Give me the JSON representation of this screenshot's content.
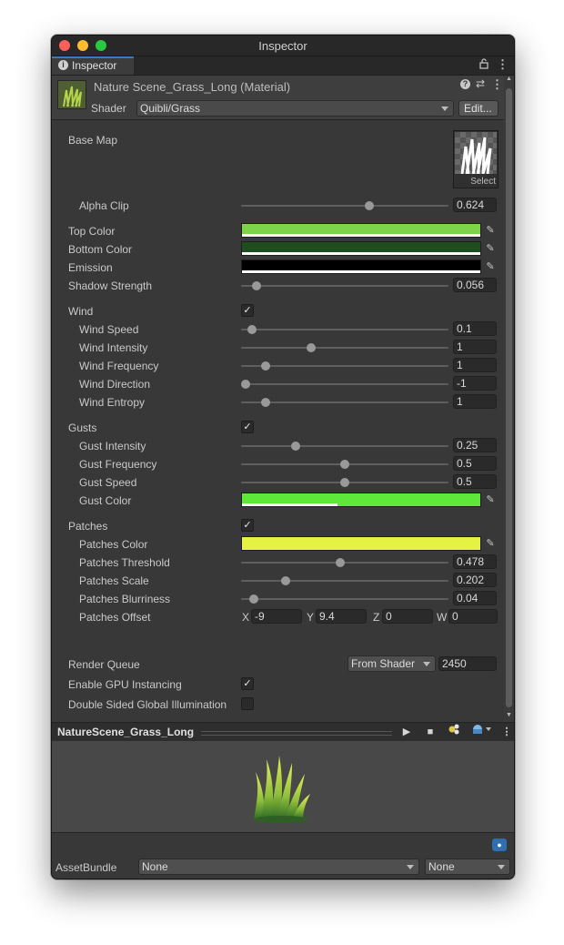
{
  "window": {
    "title": "Inspector"
  },
  "tab": {
    "label": "Inspector"
  },
  "header": {
    "material_name": "Nature Scene_Grass_Long (Material)",
    "shader_label": "Shader",
    "shader_value": "Quibli/Grass",
    "edit_button": "Edit..."
  },
  "basemap": {
    "label": "Base Map",
    "select_label": "Select"
  },
  "alpha_clip": {
    "label": "Alpha Clip",
    "value": "0.624",
    "fraction": 0.624
  },
  "colors": {
    "top": {
      "label": "Top Color",
      "hex": "#7ed448"
    },
    "bottom": {
      "label": "Bottom Color",
      "hex": "#1e4d1e"
    },
    "emission": {
      "label": "Emission",
      "hex": "#000000"
    }
  },
  "shadow_strength": {
    "label": "Shadow Strength",
    "value": "0.056",
    "fraction": 0.056
  },
  "wind": {
    "label": "Wind",
    "checked": true,
    "speed": {
      "label": "Wind Speed",
      "value": "0.1",
      "fraction": 0.03
    },
    "intensity": {
      "label": "Wind Intensity",
      "value": "1",
      "fraction": 0.33
    },
    "frequency": {
      "label": "Wind Frequency",
      "value": "1",
      "fraction": 0.1
    },
    "direction": {
      "label": "Wind Direction",
      "value": "-1",
      "fraction": 0.0
    },
    "entropy": {
      "label": "Wind Entropy",
      "value": "1",
      "fraction": 0.1
    }
  },
  "gusts": {
    "label": "Gusts",
    "checked": true,
    "intensity": {
      "label": "Gust Intensity",
      "value": "0.25",
      "fraction": 0.25
    },
    "frequency": {
      "label": "Gust Frequency",
      "value": "0.5",
      "fraction": 0.5
    },
    "speed": {
      "label": "Gust Speed",
      "value": "0.5",
      "fraction": 0.5
    },
    "color": {
      "label": "Gust Color",
      "hex": "#5ee83a"
    }
  },
  "patches": {
    "label": "Patches",
    "checked": true,
    "color": {
      "label": "Patches Color",
      "hex": "#e6f243"
    },
    "threshold": {
      "label": "Patches Threshold",
      "value": "0.478",
      "fraction": 0.478
    },
    "scale": {
      "label": "Patches Scale",
      "value": "0.202",
      "fraction": 0.202
    },
    "blurriness": {
      "label": "Patches Blurriness",
      "value": "0.04",
      "fraction": 0.04
    },
    "offset": {
      "label": "Patches Offset",
      "x_label": "X",
      "x": "-9",
      "y_label": "Y",
      "y": "9.4",
      "z_label": "Z",
      "z": "0",
      "w_label": "W",
      "w": "0"
    }
  },
  "render_queue": {
    "label": "Render Queue",
    "mode": "From Shader",
    "value": "2450"
  },
  "gpu_instancing": {
    "label": "Enable GPU Instancing",
    "checked": true
  },
  "double_sided_gi": {
    "label": "Double Sided Global Illumination",
    "checked": false
  },
  "preview": {
    "title": "NatureScene_Grass_Long"
  },
  "asset_bundle": {
    "label": "AssetBundle",
    "name": "None",
    "variant": "None"
  }
}
